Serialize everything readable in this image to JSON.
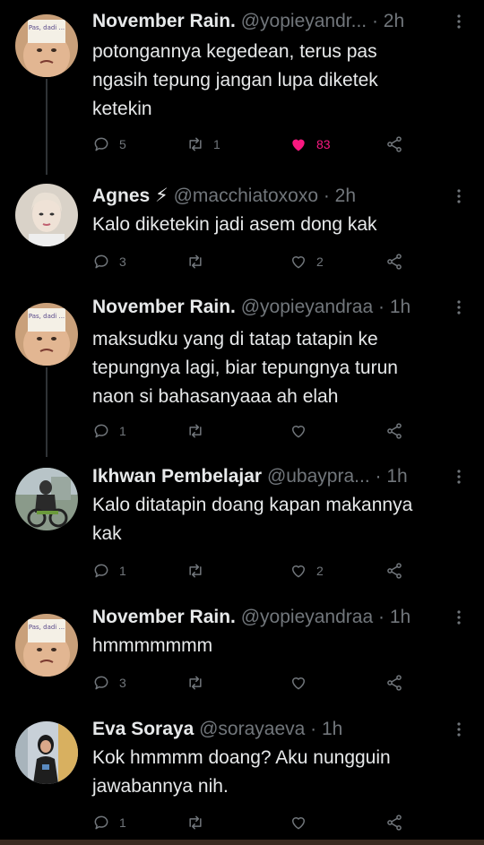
{
  "tweets": [
    {
      "name": "November Rain.",
      "handle": "@yopieyandr...",
      "time": "· 2h",
      "text": "potongannya kegedean, terus pas\nngasih tepung jangan lupa diketek\nketekin",
      "reply": "5",
      "retweet": "1",
      "like": "83",
      "liked": true,
      "avatar": "november-rain"
    },
    {
      "name": "Agnes ⚡",
      "handle": "@macchiatoxoxo",
      "time": "· 2h",
      "text": "Kalo diketekin jadi asem dong kak",
      "reply": "3",
      "retweet": "",
      "like": "2",
      "liked": false,
      "avatar": "agnes"
    },
    {
      "name": "November Rain.",
      "handle": "@yopieyandraa",
      "time": "· 1h",
      "text": "maksudku yang di tatap tatapin ke\ntepungnya lagi, biar tepungnya turun\nnaon si bahasanyaaa ah elah",
      "reply": "1",
      "retweet": "",
      "like": "",
      "liked": false,
      "avatar": "november-rain"
    },
    {
      "name": "Ikhwan Pembelajar",
      "handle": "@ubaypra...",
      "time": "· 1h",
      "text": "Kalo ditatapin doang kapan makannya\nkak",
      "reply": "1",
      "retweet": "",
      "like": "2",
      "liked": false,
      "avatar": "ikhwan"
    },
    {
      "name": "November Rain.",
      "handle": "@yopieyandraa",
      "time": "· 1h",
      "text": "hmmmmmmm",
      "reply": "3",
      "retweet": "",
      "like": "",
      "liked": false,
      "avatar": "november-rain"
    },
    {
      "name": "Eva Soraya",
      "handle": "@sorayaeva",
      "time": "· 1h",
      "text": "Kok hmmmm doang? Aku nungguin\njawabannya nih.",
      "reply": "1",
      "retweet": "",
      "like": "",
      "liked": false,
      "avatar": "eva"
    }
  ],
  "avatar_sticker_text": "Pas, dadi ...",
  "colors": {
    "background": "#000000",
    "text": "#e7e9ea",
    "muted": "#71767b",
    "like": "#f91880",
    "thread_line": "#2f3336"
  },
  "icons": [
    "reply-icon",
    "retweet-icon",
    "like-icon",
    "share-icon",
    "more-icon"
  ]
}
